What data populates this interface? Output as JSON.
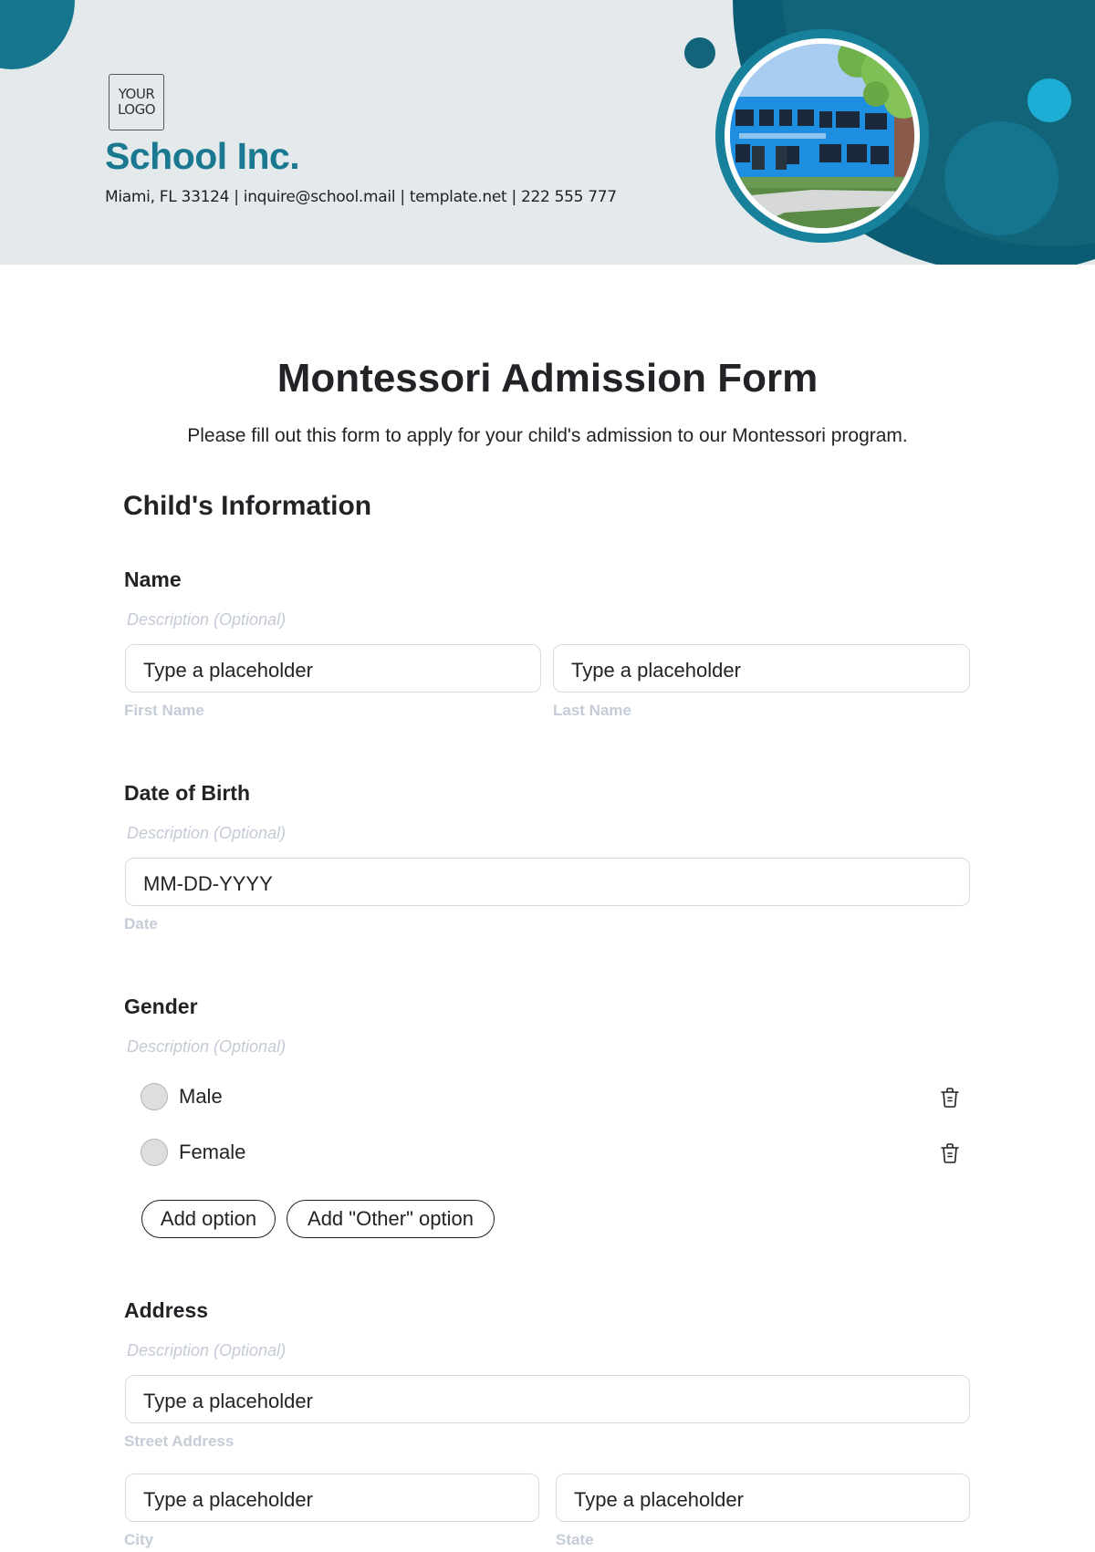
{
  "header": {
    "logo_line1": "YOUR",
    "logo_line2": "LOGO",
    "company_name": "School Inc.",
    "contact_line": "Miami, FL 33124 | inquire@school.mail | template.net | 222 555 777",
    "photo_alt": "School building photo"
  },
  "form": {
    "title": "Montessori Admission Form",
    "subtitle": "Please fill out this form to apply for your child's admission to our Montessori program.",
    "section_title": "Child's Information",
    "questions": {
      "name": {
        "label": "Name",
        "description": "Description (Optional)",
        "first": {
          "value": "Type a placeholder",
          "sublabel": "First Name"
        },
        "last": {
          "value": "Type a placeholder",
          "sublabel": "Last Name"
        }
      },
      "dob": {
        "label": "Date of Birth",
        "description": "Description (Optional)",
        "value": "MM-DD-YYYY",
        "sublabel": "Date"
      },
      "gender": {
        "label": "Gender",
        "description": "Description (Optional)",
        "options": [
          {
            "label": "Male",
            "selected": false
          },
          {
            "label": "Female",
            "selected": false
          }
        ],
        "add_option_label": "Add option",
        "add_other_label": "Add \"Other\" option"
      },
      "address": {
        "label": "Address",
        "description": "Description (Optional)",
        "street": {
          "value": "Type a placeholder",
          "sublabel": "Street Address"
        },
        "city": {
          "value": "Type a placeholder",
          "sublabel": "City"
        },
        "state": {
          "value": "Type a placeholder",
          "sublabel": "State"
        }
      }
    }
  },
  "colors": {
    "brand": "#1a7891",
    "header_bg": "#e4e9ec",
    "accent_cyan": "#1eadd4",
    "dark_teal": "#126479"
  }
}
